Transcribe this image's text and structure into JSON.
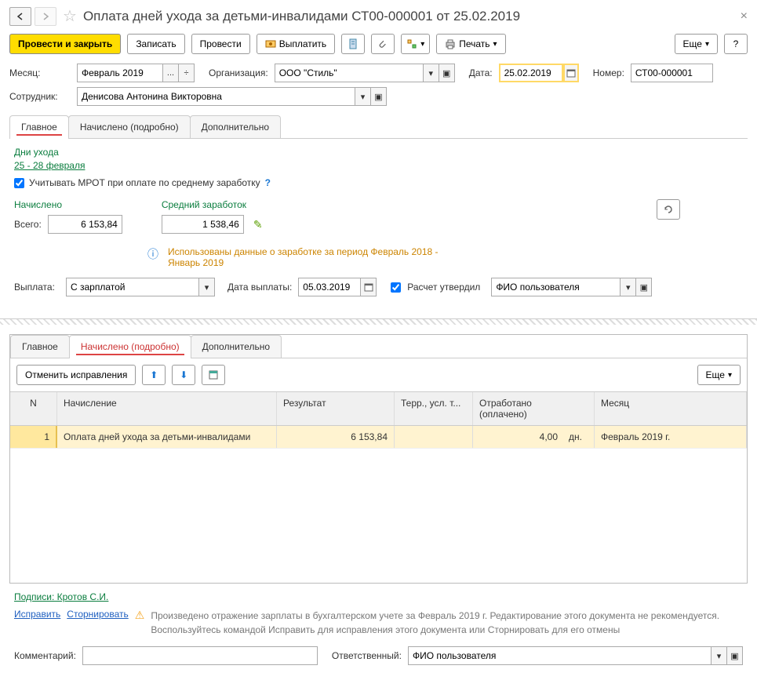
{
  "header": {
    "title": "Оплата дней ухода за детьми-инвалидами СТ00-000001 от 25.02.2019"
  },
  "toolbar": {
    "post_close": "Провести и закрыть",
    "save": "Записать",
    "post": "Провести",
    "pay": "Выплатить",
    "print": "Печать",
    "more": "Еще"
  },
  "fields": {
    "month_label": "Месяц:",
    "month_value": "Февраль 2019",
    "org_label": "Организация:",
    "org_value": "ООО \"Стиль\"",
    "date_label": "Дата:",
    "date_value": "25.02.2019",
    "number_label": "Номер:",
    "number_value": "СТ00-000001",
    "employee_label": "Сотрудник:",
    "employee_value": "Денисова Антонина Викторовна"
  },
  "tabs1": {
    "main": "Главное",
    "accrued": "Начислено (подробно)",
    "additional": "Дополнительно"
  },
  "main_tab": {
    "days_label": "Дни ухода",
    "days_link": "25 - 28 февраля",
    "checkbox_label": "Учитывать МРОТ при оплате по среднему заработку",
    "accrued_label": "Начислено",
    "avg_label": "Средний заработок",
    "total_label": "Всего:",
    "total_value": "6 153,84",
    "avg_value": "1 538,46",
    "info_text": "Использованы данные о заработке за период Февраль 2018 - Январь 2019",
    "payment_label": "Выплата:",
    "payment_value": "С зарплатой",
    "payment_date_label": "Дата выплаты:",
    "payment_date_value": "05.03.2019",
    "approved_label": "Расчет утвердил",
    "approved_value": "ФИО пользователя"
  },
  "section2": {
    "cancel_corrections": "Отменить исправления",
    "more": "Еще",
    "columns": {
      "n": "N",
      "name": "Начисление",
      "result": "Результат",
      "terr": "Терр., усл. т...",
      "worked": "Отработано (оплачено)",
      "month": "Месяц"
    },
    "rows": [
      {
        "n": "1",
        "name": "Оплата дней ухода за детьми-инвалидами",
        "result": "6 153,84",
        "worked": "4,00",
        "worked_unit": "дн.",
        "month": "Февраль 2019 г."
      }
    ]
  },
  "footer": {
    "signature": "Подписи: Кротов С.И.",
    "correct": "Исправить",
    "reverse": "Сторнировать",
    "warning1": "Произведено отражение зарплаты в бухгалтерском учете за Февраль 2019 г. Редактирование этого документа не рекомендуется.",
    "warning2": "Воспользуйтесь командой Исправить для исправления этого документа или Сторнировать для его отмены",
    "comment_label": "Комментарий:",
    "responsible_label": "Ответственный:",
    "responsible_value": "ФИО пользователя"
  }
}
